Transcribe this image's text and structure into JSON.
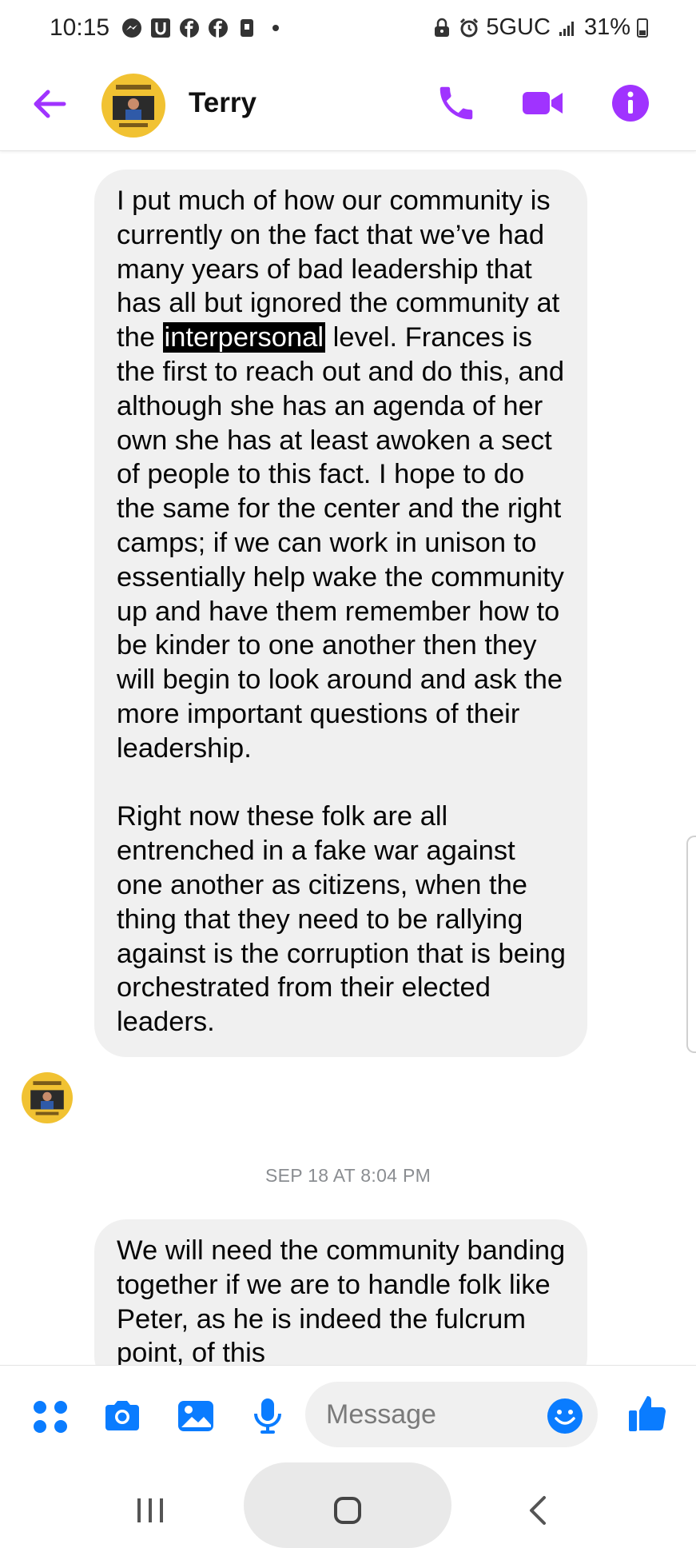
{
  "status_bar": {
    "time": "10:15",
    "network": "5GUC",
    "battery": "31%",
    "left_icons": [
      "messenger-icon",
      "u-app-icon",
      "facebook-icon",
      "facebook-icon",
      "notification-icon",
      "dot-icon"
    ],
    "right_icons": [
      "lock-icon",
      "alarm-icon",
      "signal-icon",
      "battery-icon"
    ]
  },
  "header": {
    "contact_name": "Terry",
    "accent_color": "#a033ff",
    "icons": [
      "back-arrow-icon",
      "phone-icon",
      "video-camera-icon",
      "info-icon"
    ]
  },
  "messages": [
    {
      "sender": "Terry",
      "text_before_highlight": "I put much of how our community is currently on the fact that we’ve had many years of bad leadership that has all but ignored the community at the ",
      "highlighted_text": "interpersonal",
      "text_after_highlight": " level.  Frances is the first to reach out and do this, and although she has an agenda of her own she has at least awoken a sect of people to this fact.  I hope to do the same for the center and the right camps; if we can work in unison to essentially help wake the community up and have them remember how to be kinder to one another then they will begin to look around and ask the more important questions of their leadership.",
      "paragraph_2": "Right now these folk are all entrenched in a fake war against one another as citizens, when the thing that they need to be rallying against is the corruption that is being orchestrated from their elected leaders."
    },
    {
      "sender": "Terry",
      "timestamp": "SEP 18 AT 8:04 PM",
      "text": "We will need the community banding together if we are to handle folk like Peter, as he is indeed the fulcrum point, of this"
    }
  ],
  "composer": {
    "placeholder": "Message",
    "accent_color": "#0a7cff",
    "icons": [
      "apps-grid-icon",
      "camera-icon",
      "gallery-icon",
      "microphone-icon",
      "emoji-icon",
      "thumbs-up-icon"
    ]
  },
  "nav_bar": {
    "icons": [
      "recent-apps-icon",
      "home-icon",
      "back-icon"
    ]
  }
}
